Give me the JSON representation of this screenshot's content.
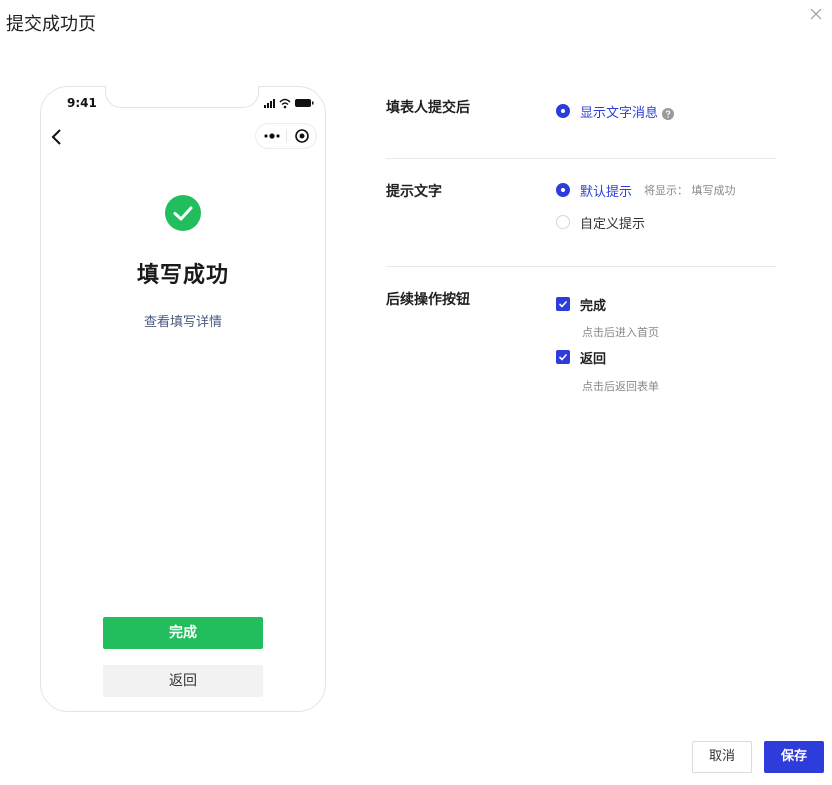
{
  "dialog": {
    "title": "提交成功页",
    "close_icon": "close-icon"
  },
  "preview": {
    "status_time": "9:41",
    "success_title": "填写成功",
    "detail_link": "查看填写详情",
    "primary_button": "完成",
    "secondary_button": "返回",
    "colors": {
      "success": "#22be5d",
      "link": "#4a5a80"
    }
  },
  "settings": {
    "after_submit": {
      "label": "填表人提交后",
      "options": [
        {
          "label": "显示文字消息",
          "selected": true,
          "has_help_icon": true
        }
      ]
    },
    "prompt_text": {
      "label": "提示文字",
      "options": [
        {
          "label": "默认提示",
          "selected": true,
          "hint": "将显示： 填写成功"
        },
        {
          "label": "自定义提示",
          "selected": false
        }
      ]
    },
    "followup_buttons": {
      "label": "后续操作按钮",
      "options": [
        {
          "label": "完成",
          "checked": true,
          "hint": "点击后进入首页"
        },
        {
          "label": "返回",
          "checked": true,
          "hint": "点击后返回表单"
        }
      ]
    }
  },
  "footer": {
    "cancel_label": "取消",
    "save_label": "保存"
  },
  "colors": {
    "accent": "#2d3cda"
  }
}
